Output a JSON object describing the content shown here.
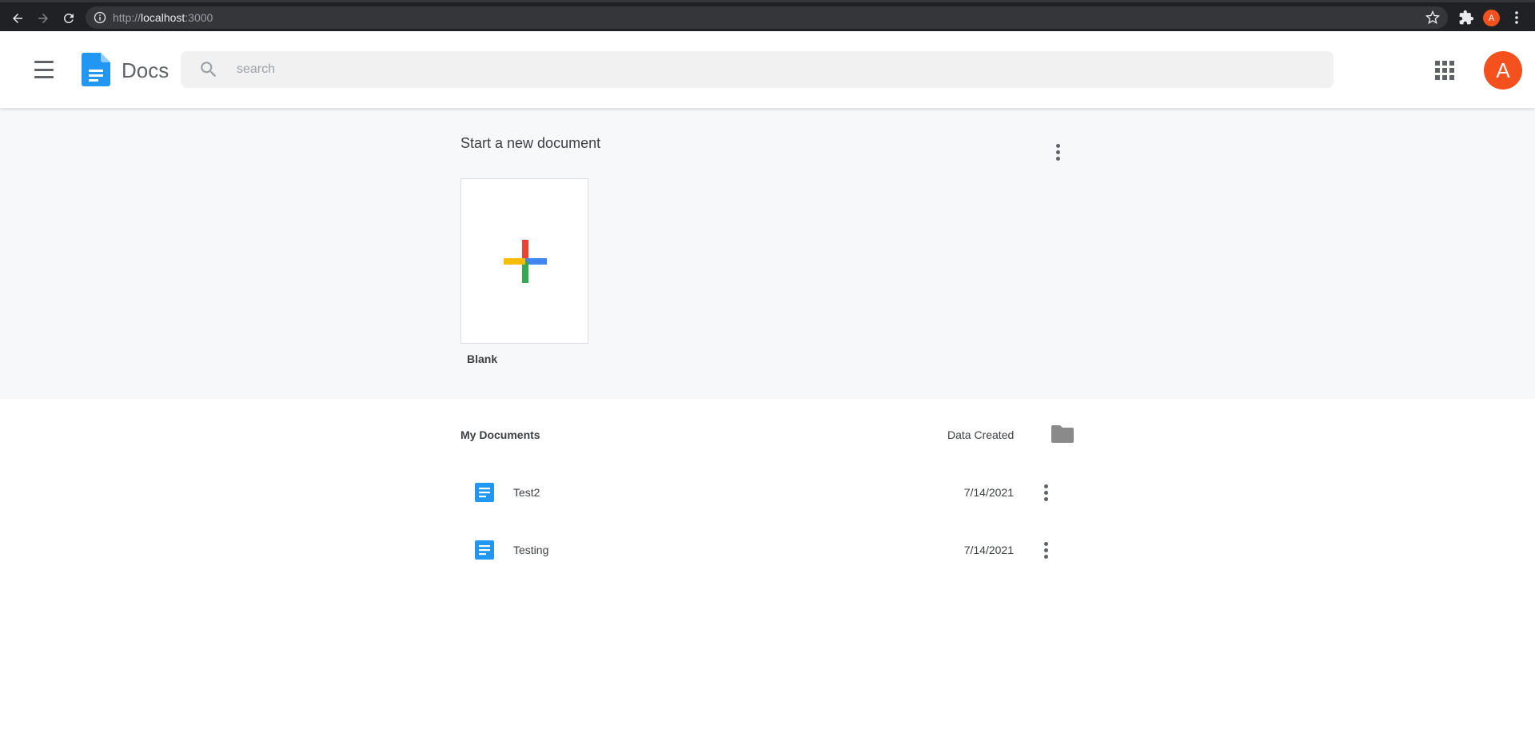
{
  "browser": {
    "url_scheme": "http://",
    "url_host": "localhost",
    "url_port": ":3000",
    "profile_initial": "A",
    "icons": [
      "back-icon",
      "forward-icon",
      "reload-icon",
      "info-icon",
      "star-icon",
      "extensions-icon",
      "menu-icon"
    ]
  },
  "header": {
    "title": "Docs",
    "search_placeholder": "search",
    "avatar_initial": "A",
    "avatar_color": "#f4511e",
    "brand_color": "#2196f3"
  },
  "templates": {
    "title": "Start a new document",
    "items": [
      {
        "label": "Blank"
      }
    ]
  },
  "documents": {
    "title": "My Documents",
    "date_column": "Data Created",
    "rows": [
      {
        "title": "Test2",
        "date": "7/14/2021"
      },
      {
        "title": "Testing",
        "date": "7/14/2021"
      }
    ]
  }
}
